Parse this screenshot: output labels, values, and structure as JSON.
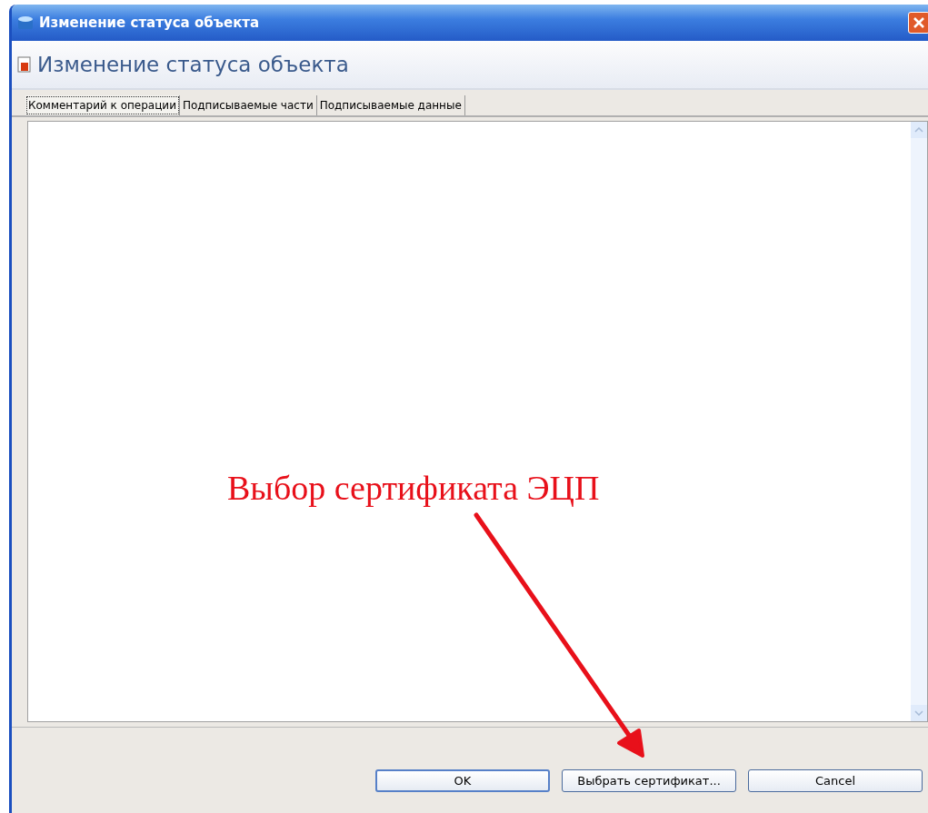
{
  "window": {
    "title": "Изменение статуса объекта"
  },
  "header": {
    "title": "Изменение статуса объекта"
  },
  "tabs": [
    {
      "label": "Комментарий к операции",
      "selected": true
    },
    {
      "label": "Подписываемые части",
      "selected": false
    },
    {
      "label": "Подписываемые данные",
      "selected": false
    }
  ],
  "annotation": {
    "text": "Выбор сертификата ЭЦП"
  },
  "buttons": [
    {
      "label": "OK",
      "kind": "default"
    },
    {
      "label": "Выбрать сертификат...",
      "kind": "normal"
    },
    {
      "label": "Cancel",
      "kind": "normal"
    }
  ]
}
